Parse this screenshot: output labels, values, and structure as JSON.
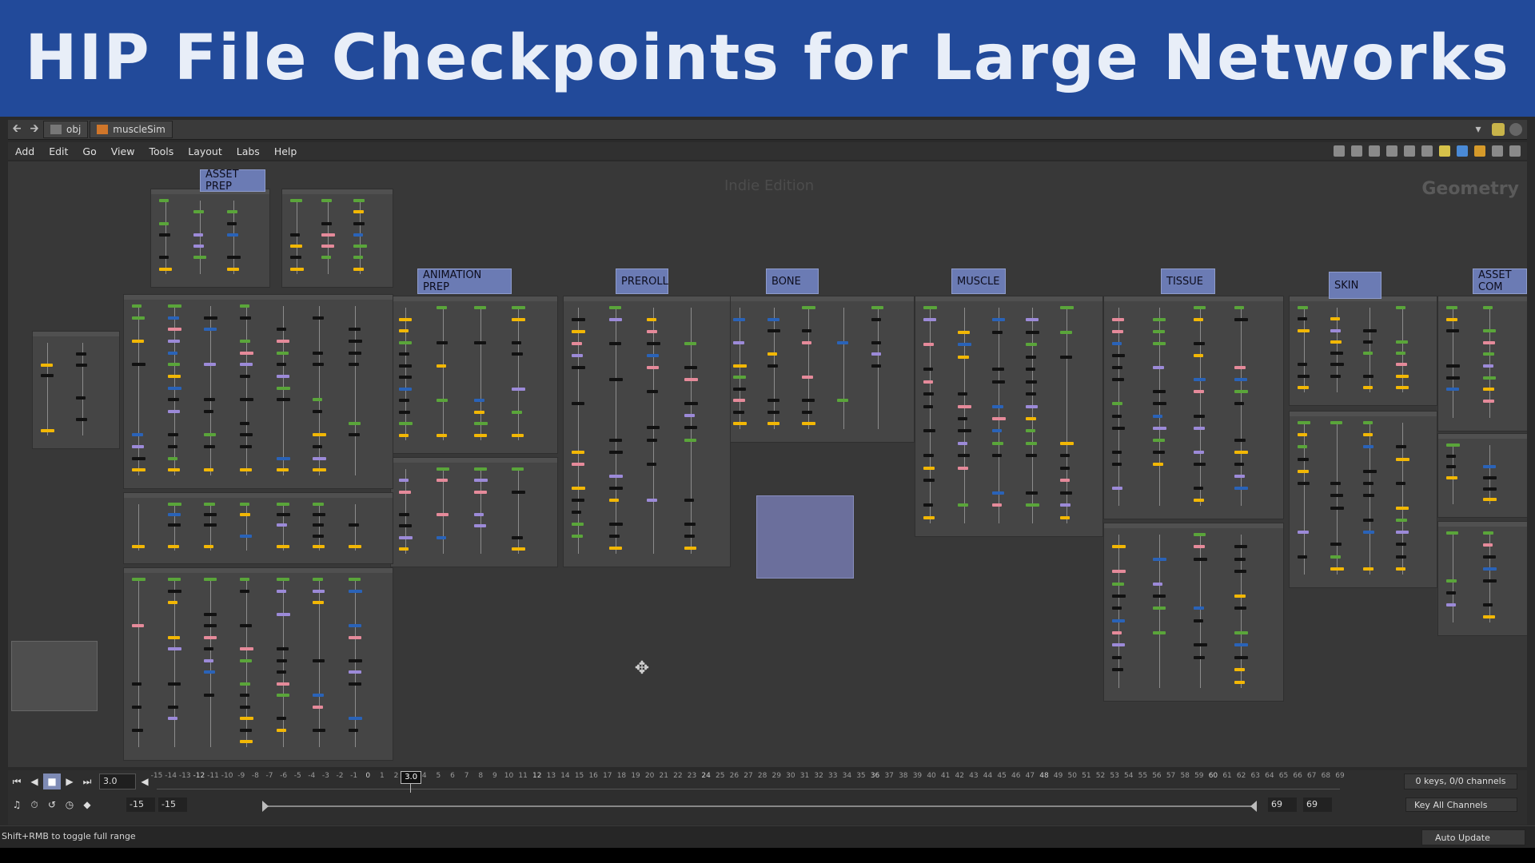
{
  "banner": {
    "title": "HIP File Checkpoints for Large Networks"
  },
  "pathbar": {
    "crumbs": [
      "obj",
      "muscleSim"
    ]
  },
  "menu": {
    "items": [
      "Add",
      "Edit",
      "Go",
      "View",
      "Tools",
      "Layout",
      "Labs",
      "Help"
    ]
  },
  "network": {
    "watermark": "Indie Edition",
    "context_label": "Geometry",
    "stickies": [
      "ASSET PREP",
      "ANIMATION PREP",
      "PREROLL",
      "BONE",
      "MUSCLE",
      "TISSUE",
      "SKIN",
      "ASSET COM"
    ],
    "colors": {
      "node_black": "#111111",
      "node_green": "#5aa53a",
      "node_blue": "#2a63b8",
      "node_yellow": "#f2b705",
      "node_pink": "#e58a9a",
      "node_purple": "#9c8ad8",
      "sticky": "#6b7bb4"
    }
  },
  "playbar": {
    "current_frame": "3.0",
    "cursor_frame": "3.0",
    "ticks": [
      "-15",
      "-14",
      "-13",
      "-12",
      "-11",
      "-10",
      "-9",
      "-8",
      "-7",
      "-6",
      "-5",
      "-4",
      "-3",
      "-2",
      "-1",
      "0",
      "1",
      "2",
      "3",
      "4",
      "5",
      "6",
      "7",
      "8",
      "9",
      "10",
      "11",
      "12",
      "13",
      "14",
      "15",
      "16",
      "17",
      "18",
      "19",
      "20",
      "21",
      "22",
      "23",
      "24",
      "25",
      "26",
      "27",
      "28",
      "29",
      "30",
      "31",
      "32",
      "33",
      "34",
      "35",
      "36",
      "37",
      "38",
      "39",
      "40",
      "41",
      "42",
      "43",
      "44",
      "45",
      "46",
      "47",
      "48",
      "49",
      "50",
      "51",
      "52",
      "53",
      "54",
      "55",
      "56",
      "57",
      "58",
      "59",
      "60",
      "61",
      "62",
      "63",
      "64",
      "65",
      "66",
      "67",
      "68",
      "69"
    ],
    "keys_label": "0 keys, 0/0 channels",
    "range_start": "-15",
    "range_start2": "-15",
    "range_end": "69",
    "range_end2": "69",
    "key_all": "Key All Channels"
  },
  "status": {
    "message": "Shift+RMB to toggle full range",
    "auto_update": "Auto Update"
  }
}
